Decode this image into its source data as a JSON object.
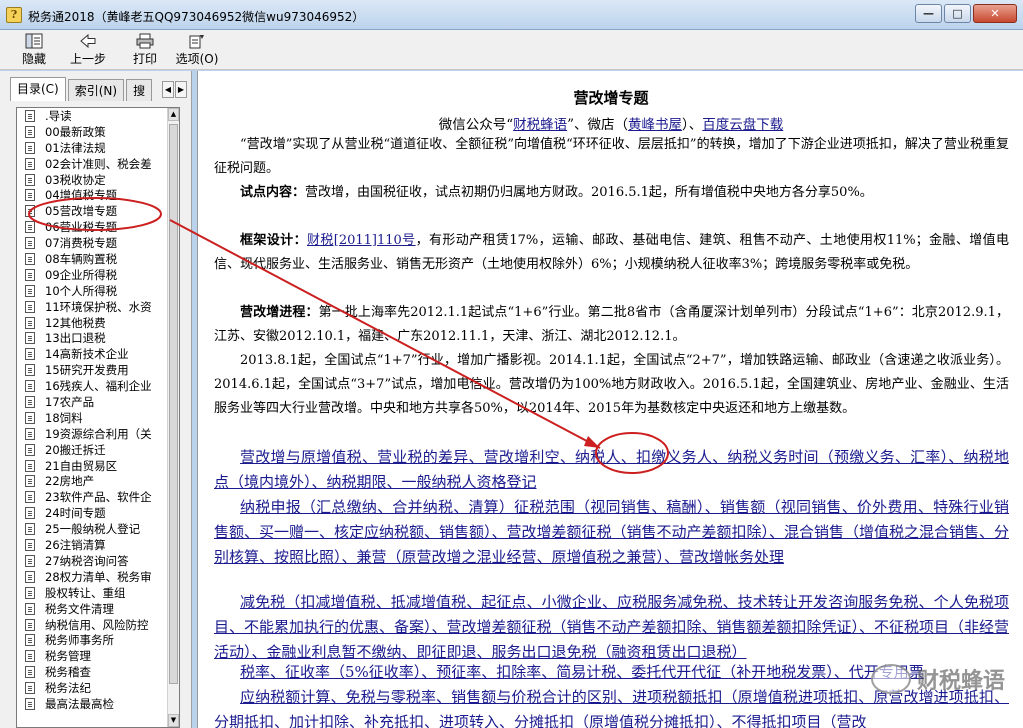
{
  "window": {
    "title": "税务通2018（黄峰老五QQ973046952微信wu973046952）",
    "icon": "help-book-icon",
    "app_icon_glyph": "?",
    "minimize_glyph": "—",
    "maximize_glyph": "□",
    "close_glyph": "✕"
  },
  "toolbar": {
    "hide_label": "隐藏",
    "back_label": "上一步",
    "print_label": "打印",
    "options_label": "选项(O)"
  },
  "sidebar": {
    "tab_contents": "目录(C)",
    "tab_index": "索引(N)",
    "tab_search": "搜",
    "items": [
      ".导读",
      "00最新政策",
      "01法律法规",
      "02会计准则、税会差",
      "03税收协定",
      "04增值税专题",
      "05营改增专题",
      "06营业税专题",
      "07消费税专题",
      "08车辆购置税",
      "09企业所得税",
      "10个人所得税",
      "11环境保护税、水资",
      "12其他税费",
      "13出口退税",
      "14高新技术企业",
      "15研究开发费用",
      "16残疾人、福利企业",
      "17农产品",
      "18饲料",
      "19资源综合利用（关",
      "20搬迁拆迁",
      "21自由贸易区",
      "22房地产",
      "23软件产品、软件企",
      "24时间专题",
      "25一般纳税人登记",
      "26注销清算",
      "27纳税咨询问答",
      "28权力清单、税务审",
      "股权转让、重组",
      "税务文件清理",
      "纳税信用、风险防控",
      "税务师事务所",
      "税务管理",
      "税务稽查",
      "税务法纪",
      "最高法最高检"
    ]
  },
  "document": {
    "title": "营改增专题",
    "sub_prefix": "微信公众号“",
    "sub_link1": "财税蜂语",
    "sub_mid": "”、微店（",
    "sub_link2": "黄峰书屋",
    "sub_mid2": "）、",
    "sub_link3": "百度云盘下载",
    "intro": "“营改增”实现了从营业税“道道征收、全额征税”向增值税“环环征收、层层抵扣”的转换，增加了下游企业进项抵扣，解决了营业税重复征税问题。",
    "pilot_label": "试点内容：",
    "pilot_text": "营改增，由国税征收，试点初期仍归属地方财政。2016.5.1起，所有增值税中央地方各分享50%。",
    "framework_label": "框架设计：",
    "framework_link": "财税[2011]110号",
    "framework_text": "，有形动产租赁17%，运输、邮政、基础电信、建筑、租售不动产、土地使用权11%；金融、增值电信、现代服务业、生活服务业、销售无形资产（土地使用权除外）6%；小规模纳税人征收率3%；跨境服务零税率或免税。",
    "progress_label": "营改增进程：",
    "progress_text": "第一批上海率先2012.1.1起试点“1+6”行业。第二批8省市（含甬厦深计划单列市）分段试点“1+6”：北京2012.9.1，江苏、安徽2012.10.1，福建、广东2012.11.1，天津、浙江、湖北2012.12.1。",
    "progress_text2": "2013.8.1起，全国试点“1+7”行业，增加广播影视。2014.1.1起，全国试点“2+7”，增加铁路运输、邮政业（含速递之收派业务）。2014.6.1起，全国试点“3+7”试点，增加电信业。营改增仍为100%地方财政收入。2016.5.1起，全国建筑业、房地产业、金融业、生活服务业等四大行业营改增。中央和地方共享各50%，以2014年、2015年为基数核定中央返还和地方上缴基数。",
    "links_p1": "营改增与原增值税、营业税的差异、营改增利空、纳税人、扣缴义务人、纳税义务时间（预缴义务、汇率）、纳税地点（境内境外）、纳税期限、一般纳税人资格登记",
    "links_p2": "纳税申报（汇总缴纳、合并纳税、清算）征税范围（视同销售、稿酬）、销售额（视同销售、价外费用、特殊行业销售额、买一赠一、核定应纳税额、销售额）、营改增差额征税（销售不动产差额扣除）、混合销售（增值税之混合销售、分别核算、按照比照）、兼营（原营改增之混业经营、原增值税之兼营）、营改增帐务处理",
    "links_p3": "减免税（扣减增值税、抵减增值税、起征点、小微企业、应税服务减免税、技术转让开发咨询服务免税、个人免税项目、不能累加执行的优惠、备案）、营改增差额征税（销售不动产差额扣除、销售额差额扣除凭证）、不征税项目（非经营活动）、金融业利息暂不缴纳、即征即退、服务出口退免税（融资租赁出口退税）",
    "links_p4": "税率、征收率（5%征收率）、预征率、扣除率、简易计税、委托代开代征（补开地税发票）、代开专用票",
    "links_p5": "应纳税额计算、免税与零税率、销售额与价税合计的区别、进项税额抵扣（原增值税进项抵扣、原营改增进项抵扣、分期抵扣、加计扣除、补充抵扣、进项转入、分摊抵扣（原增值税分摊抵扣）、不得抵扣项目（营改"
  },
  "watermark": {
    "text": "财税蜂语"
  },
  "colors": {
    "link": "#1b1b8f",
    "annotation": "#cc1f1f",
    "title_bar": "#c6d9ef"
  }
}
